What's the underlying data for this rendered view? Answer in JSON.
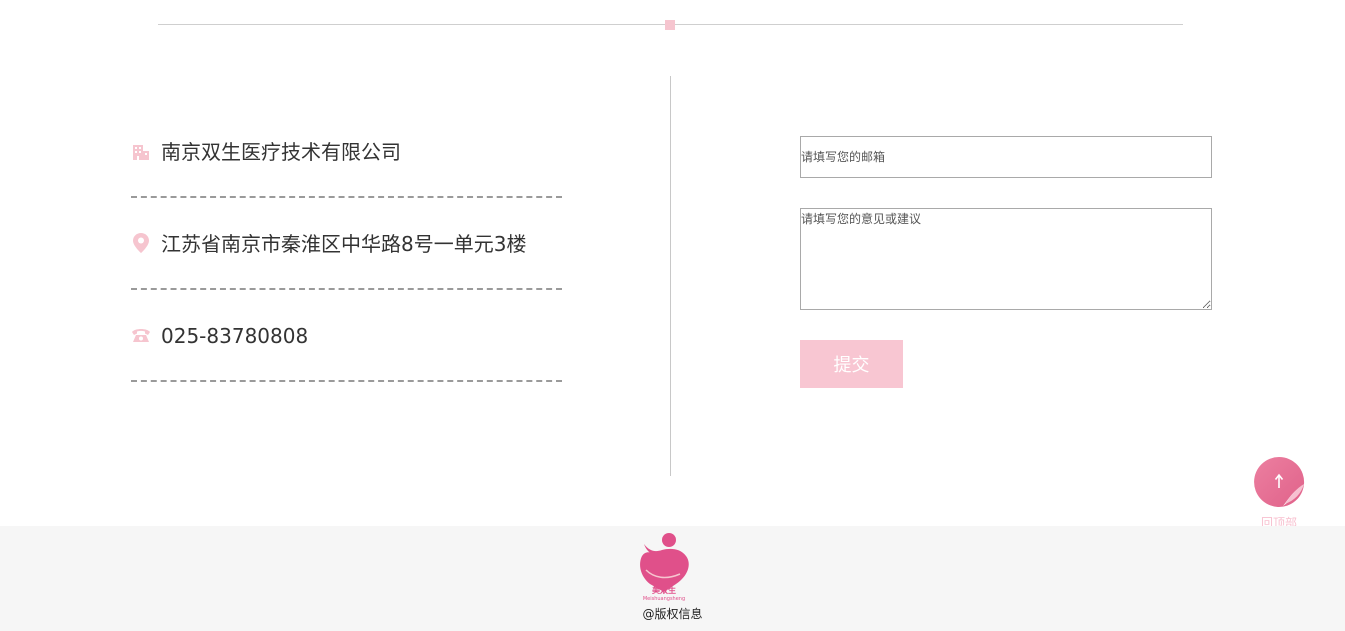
{
  "contact": {
    "company": "南京双生医疗技术有限公司",
    "address": "江苏省南京市秦淮区中华路8号一单元3楼",
    "phone": "025-83780808"
  },
  "icons": {
    "company": "building-icon",
    "address": "location-pin-icon",
    "phone": "telephone-icon"
  },
  "form": {
    "email_placeholder": "请填写您的邮箱",
    "message_placeholder": "请填写您的意见或建议",
    "submit_label": "提交"
  },
  "back_to_top": {
    "label": "回顶部"
  },
  "footer": {
    "logo_text": "美双生",
    "logo_subtext": "Meishuangsheng",
    "copyright": "@版权信息"
  },
  "colors": {
    "accent": "#f8c6d2",
    "logo_pink": "#e0508a",
    "divider": "#cfcfcf",
    "footer_bg": "#f6f6f6"
  }
}
